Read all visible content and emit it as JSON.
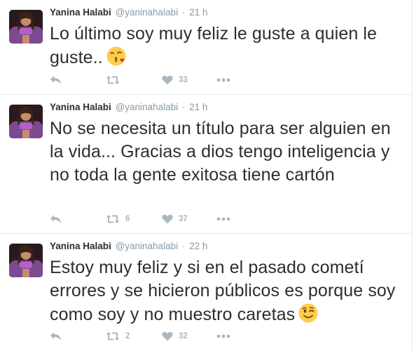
{
  "colors": {
    "text": "#292f33",
    "meta": "#8899a6",
    "action_icon": "#aab8c2",
    "divider": "#e1e8ed"
  },
  "tweets": [
    {
      "fullname": "Yanina Halabi",
      "username": "@yaninahalabi",
      "dot": "·",
      "time": "21 h",
      "text": "Lo último soy muy feliz le guste a quien le guste..",
      "emoji": "face-blowing-kiss-emoji",
      "retweets": "",
      "likes": "33"
    },
    {
      "fullname": "Yanina Halabi",
      "username": "@yaninahalabi",
      "dot": "·",
      "time": "21 h",
      "text": "No se necesita un título para ser alguien en la vida... Gracias a dios tengo inteligencia y no toda la gente exitosa tiene cartón",
      "emoji": "",
      "retweets": "6",
      "likes": "37"
    },
    {
      "fullname": "Yanina Halabi",
      "username": "@yaninahalabi",
      "dot": "·",
      "time": "22 h",
      "text": "Estoy muy feliz y si en el pasado cometí errores y se hicieron públicos es porque soy como soy y no muestro caretas",
      "emoji": "winking-face-emoji",
      "retweets": "2",
      "likes": "32"
    }
  ]
}
